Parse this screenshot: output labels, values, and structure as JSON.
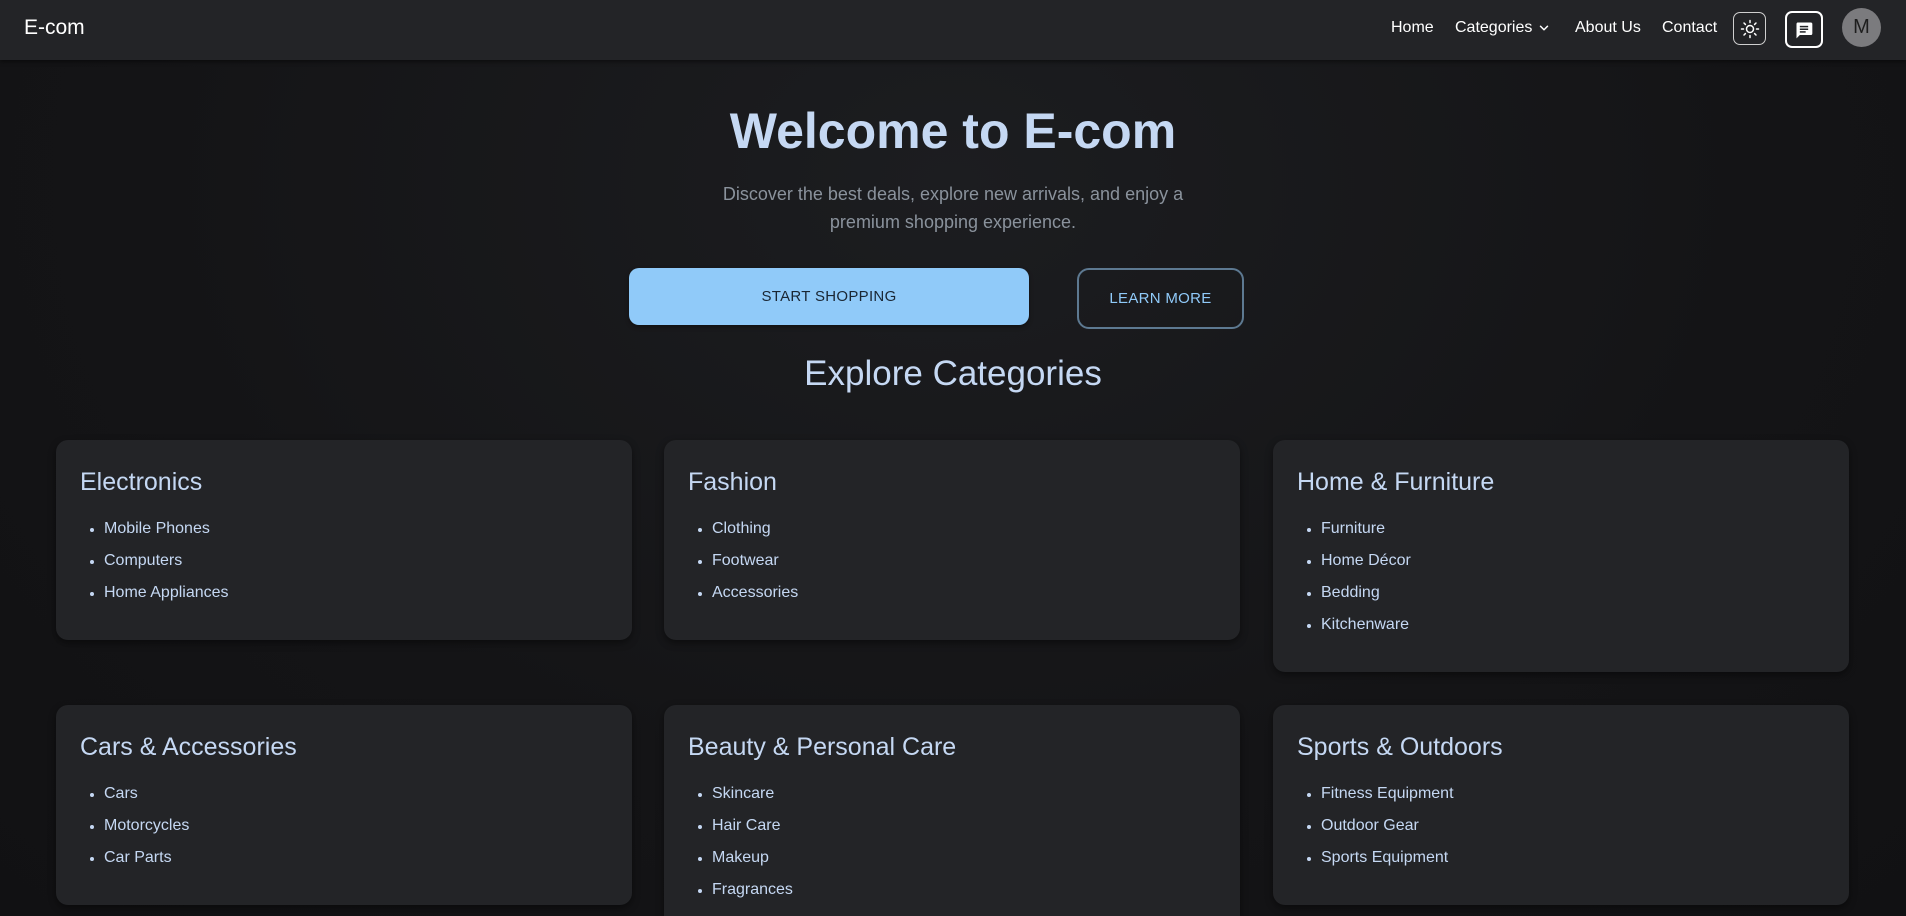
{
  "header": {
    "brand": "E-com",
    "nav": {
      "home": "Home",
      "categories": "Categories",
      "about": "About Us",
      "contact": "Contact"
    },
    "avatar_initial": "M"
  },
  "hero": {
    "title": "Welcome to E-com",
    "subtitle": "Discover the best deals, explore new arrivals, and enjoy a premium shopping experience.",
    "primary_button": "START SHOPPING",
    "secondary_button": "LEARN MORE"
  },
  "categories": {
    "title": "Explore Categories",
    "cards": [
      {
        "title": "Electronics",
        "items": [
          "Mobile Phones",
          "Computers",
          "Home Appliances"
        ]
      },
      {
        "title": "Fashion",
        "items": [
          "Clothing",
          "Footwear",
          "Accessories"
        ]
      },
      {
        "title": "Home & Furniture",
        "items": [
          "Furniture",
          "Home Décor",
          "Bedding",
          "Kitchenware"
        ]
      },
      {
        "title": "Cars & Accessories",
        "items": [
          "Cars",
          "Motorcycles",
          "Car Parts"
        ]
      },
      {
        "title": "Beauty & Personal Care",
        "items": [
          "Skincare",
          "Hair Care",
          "Makeup",
          "Fragrances"
        ]
      },
      {
        "title": "Sports & Outdoors",
        "items": [
          "Fitness Equipment",
          "Outdoor Gear",
          "Sports Equipment"
        ]
      }
    ]
  },
  "colors": {
    "accent": "#90caf9",
    "background": "#141416",
    "surface": "#232427",
    "text": "#c5d8f3"
  },
  "icons": {
    "theme": "sun-icon",
    "chat": "chat-icon",
    "dropdown": "chevron-down-icon",
    "list_bullet": "bullet-icon"
  }
}
